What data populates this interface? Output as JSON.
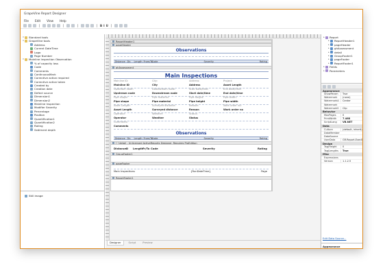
{
  "app": {
    "title": "GrapeVine Report Designer",
    "menu": [
      "File",
      "Edit",
      "View",
      "Help"
    ],
    "toolbar_font_controls": [
      "B",
      "I",
      "U"
    ]
  },
  "colors": {
    "window_border": "#e08a1e",
    "title_blue": "#1f3f96"
  },
  "toolbox": {
    "items": [
      {
        "label": "Standard tools",
        "level": 0,
        "icon": "folder-icon"
      },
      {
        "label": "GrapeVine tools",
        "level": 0,
        "icon": "folder-icon"
      },
      {
        "label": "Address",
        "level": 1,
        "icon": "field-icon"
      },
      {
        "label": "Current DateTime",
        "level": 1,
        "icon": "clock-icon"
      },
      {
        "label": "Logo",
        "level": 1,
        "icon": "image-icon"
      },
      {
        "label": "Page Number",
        "level": 1,
        "icon": "field-icon"
      },
      {
        "label": "Mainline Inspection Observation",
        "level": 0,
        "icon": "folder-icon"
      },
      {
        "label": "% of capacity loss",
        "level": 1,
        "icon": "field-icon"
      },
      {
        "label": "Code",
        "level": 1,
        "icon": "table-icon"
      },
      {
        "label": "Comments",
        "level": 1,
        "icon": "field-icon"
      },
      {
        "label": "ContinuousMark",
        "level": 1,
        "icon": "field-icon"
      },
      {
        "label": "Corrective action required",
        "level": 1,
        "icon": "field-icon"
      },
      {
        "label": "Corrective action taken",
        "level": 1,
        "icon": "field-icon"
      },
      {
        "label": "Created by",
        "level": 1,
        "icon": "table-icon"
      },
      {
        "label": "Creation date",
        "level": 1,
        "icon": "field-icon"
      },
      {
        "label": "Defect source",
        "level": 1,
        "icon": "field-icon"
      },
      {
        "label": "Dimension1",
        "level": 1,
        "icon": "field-icon"
      },
      {
        "label": "Dimension2",
        "level": 1,
        "icon": "field-icon"
      },
      {
        "label": "Mainline Inspection",
        "level": 1,
        "icon": "table-icon"
      },
      {
        "label": "Modifier Severity",
        "level": 1,
        "icon": "field-icon"
      },
      {
        "label": "Percentage",
        "level": 1,
        "icon": "field-icon"
      },
      {
        "label": "Position",
        "level": 1,
        "icon": "table-icon"
      },
      {
        "label": "Quantification1",
        "level": 1,
        "icon": "field-icon"
      },
      {
        "label": "Quantification2",
        "level": 1,
        "icon": "field-icon"
      },
      {
        "label": "Rating",
        "level": 1,
        "icon": "field-icon"
      },
      {
        "label": "Sediment depth",
        "level": 1,
        "icon": "field-icon"
      }
    ],
    "bottom_item": "Still image"
  },
  "designer": {
    "bands": {
      "report_header": "ReportHeader1",
      "page_header": "pageHeader",
      "gh": "ghAssessment",
      "detail": "[ ] detail - Unlicensed ActiveReports Designer. Requires ProEdition",
      "group_footer": "GroupFooter1",
      "page_footer": "pageFooter",
      "report_footer": "ReportFooter1"
    },
    "observations_title": "Observations",
    "observation_cols": [
      "Distance",
      "Dir.",
      "Length",
      "From/To",
      "Code",
      "Severity",
      "Rating"
    ],
    "main_inspections_title": "Main Inspections",
    "mi_rows": [
      [
        "Mainline ID:",
        "City:",
        "Address:",
        "Project:"
      ],
      [
        "Mainline ID",
        "City",
        "Address",
        "Asset Length"
      ],
      [
        "Upstream node:",
        "Downstream node:",
        "Start date/time:",
        "End date/time:"
      ],
      [
        "Upstream node",
        "Downstream node",
        "Start date/time",
        "End date/time"
      ],
      [
        "Pipe shape:",
        "Pipe material:",
        "Pipe height:",
        "Pipe width:"
      ],
      [
        "Pipe shape",
        "Pipe material",
        "Pipe height",
        "Pipe width"
      ],
      [
        "Asset Length:",
        "Surveyed distance:",
        "Reason:",
        "Work order no:"
      ],
      [
        "Asset Length",
        "Surveyed distance",
        "Reason",
        "Work order no"
      ],
      [
        "Operator:",
        "Weather:",
        "Status:",
        ""
      ],
      [
        "Operator",
        "Weather",
        "Status",
        ""
      ],
      [
        "Comments:",
        "",
        "",
        ""
      ],
      [
        "Comments",
        "",
        "",
        ""
      ]
    ],
    "detail_fields": [
      "Distance",
      "D",
      "Length",
      "Fr/To",
      "Code",
      "Severity",
      "Rating"
    ],
    "footer": {
      "left": "Main Inspections",
      "middle": "{RunDateTime}",
      "right": "Page"
    },
    "tabs": [
      "Designer",
      "Script",
      "Preview"
    ]
  },
  "report_explorer": {
    "items": [
      {
        "label": "Report",
        "level": 0
      },
      {
        "label": "ReportHeader1",
        "level": 1
      },
      {
        "label": "pageHeader",
        "level": 1
      },
      {
        "label": "ghAssessment",
        "level": 1
      },
      {
        "label": "detail",
        "level": 1
      },
      {
        "label": "GroupFooter1",
        "level": 1
      },
      {
        "label": "pageFooter",
        "level": 1
      },
      {
        "label": "ReportFooter1",
        "level": 1
      },
      {
        "label": "Fields",
        "level": 0
      },
      {
        "label": "Parameters",
        "level": 0
      }
    ]
  },
  "properties": {
    "categories": [
      {
        "name": "Appearance",
        "rows": [
          [
            "ShowParam",
            "True"
          ],
          [
            "Watermark",
            "(none)"
          ],
          [
            "WatermarkA",
            "Center"
          ],
          [
            "Watermark",
            ""
          ],
          [
            "WatermarkS",
            "Clip"
          ]
        ]
      },
      {
        "name": "Behavior",
        "rows": [
          [
            "MaxPages",
            "0"
          ],
          [
            "PrintWidth",
            "7.468"
          ],
          [
            "ScriptLang",
            "VB.NET"
          ]
        ]
      },
      {
        "name": "Data",
        "rows": [
          [
            "Culture",
            "(default, inherit)"
          ],
          [
            "DataMember",
            ""
          ],
          [
            "DataSource",
            ""
          ],
          [
            "UserData",
            "GR.Report.ExecID"
          ]
        ]
      },
      {
        "name": "Design",
        "rows": [
          [
            "Tag/Height",
            "0"
          ],
          [
            "Tag/Lengths",
            "True"
          ]
        ]
      },
      {
        "name": "Misc",
        "rows": [
          [
            "Expressions",
            ""
          ],
          [
            "Version",
            "1.1.2.5"
          ]
        ]
      }
    ],
    "edit_link": "Edit Data Source...",
    "appearance_label": "Appearance"
  }
}
